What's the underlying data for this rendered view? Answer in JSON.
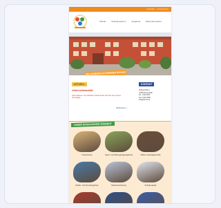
{
  "topbar": {
    "links": "Kontakt · Impressum"
  },
  "header": {
    "nav": [
      "Schule",
      "Schulprogramm",
      "Angebote",
      "Elterninformation"
    ]
  },
  "hero": {
    "banner": "WILLKOMMEN AN UNSERER SCHULE"
  },
  "news": {
    "tag": "AKTUELL",
    "title": "Unterrichtsausfall",
    "text": "Informationen zum aktuellen Stand finden Sie hier auf unserer Homepage.",
    "more": "Weiterlesen »"
  },
  "contact": {
    "tag": "KONTAKT",
    "lines": [
      "Musterstraße 1",
      "12345 Musterstadt",
      "Tel.: 0123 4567",
      "Fax: 0123 4568",
      "info@schule.de"
    ]
  },
  "offer": {
    "tag": "UNSER SCHULISCHES ANGEBOT",
    "tiles": [
      {
        "label": "Förderkurse",
        "color": "#d9b27a"
      },
      {
        "label": "Sport- und Bewegungsangebote",
        "color": "#8aa55a"
      },
      {
        "label": "Offene Ganztagsschule",
        "color": "#6b4f3a"
      },
      {
        "label": "Musik- und Kunstangebote",
        "color": "#4a7aa8"
      },
      {
        "label": "Medienerziehung",
        "color": "#b9c3d6"
      },
      {
        "label": "Schulprojekte",
        "color": "#e0e4ec"
      },
      {
        "label": "",
        "color": "#a63b2e"
      },
      {
        "label": "",
        "color": "#2d4f8a"
      },
      {
        "label": "",
        "color": "#3b5fae"
      }
    ]
  }
}
